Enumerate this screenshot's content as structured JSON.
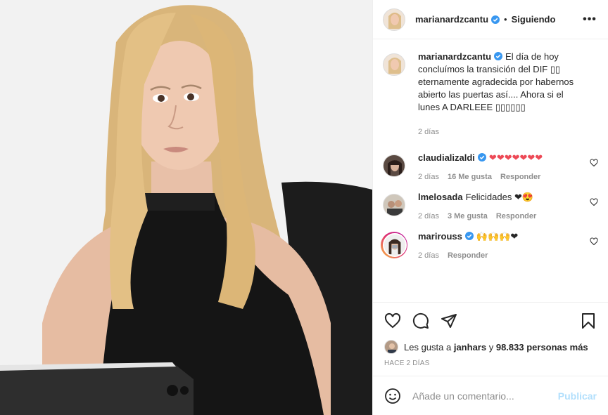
{
  "header": {
    "username": "marianardzcantu",
    "separator": "•",
    "follow_label": "Siguiendo",
    "more_icon": "more-dots-icon",
    "more_label": "•••"
  },
  "caption": {
    "username": "marianardzcantu",
    "text": "El día de hoy concluímos la transición del DIF ▯▯ eternamente agradecida por habernos abierto las puertas así.... Ahora si el lunes A DARLEEE ▯▯▯▯▯▯",
    "time": "2 días"
  },
  "comments": [
    {
      "username": "claudializaldi",
      "verified": true,
      "text": "❤❤❤❤❤❤❤",
      "time": "2 días",
      "likes": "16 Me gusta",
      "reply": "Responder"
    },
    {
      "username": "lmelosada",
      "verified": false,
      "text": "Felicidades ❤😍",
      "time": "2 días",
      "likes": "3 Me gusta",
      "reply": "Responder"
    },
    {
      "username": "marirouss",
      "verified": true,
      "text": "🙌🙌🙌❤",
      "time": "2 días",
      "likes": "",
      "reply": "Responder"
    }
  ],
  "actions": {
    "like_icon": "heart-icon",
    "comment_icon": "comment-icon",
    "share_icon": "share-icon",
    "save_icon": "bookmark-icon"
  },
  "likes": {
    "prefix": "Les gusta a",
    "user": "janhars",
    "connector": "y",
    "count": "98.833 personas más"
  },
  "posted_ago": "HACE 2 DÍAS",
  "add_comment": {
    "placeholder": "Añade un comentario...",
    "publish_label": "Publicar"
  },
  "colors": {
    "verified": "#3897f0",
    "heart": "#ed4956",
    "publish_disabled": "#b2dffc",
    "muted": "#8e8e8e"
  }
}
